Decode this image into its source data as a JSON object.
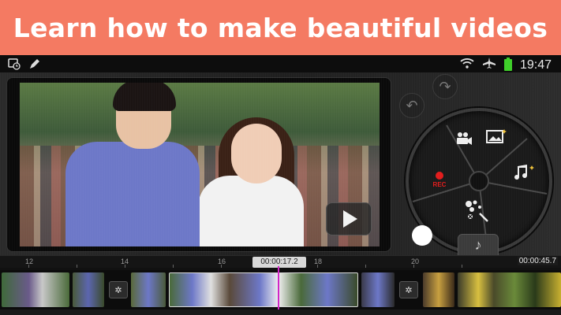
{
  "banner": {
    "title": "Learn how to make beautiful videos"
  },
  "statusbar": {
    "time": "19:47",
    "left_icons": [
      "alarm-clock-icon",
      "pencil-icon"
    ],
    "right_icons": [
      "wifi-icon",
      "airplane-icon",
      "battery-icon"
    ],
    "battery_color": "#3fcf2a"
  },
  "preview": {
    "play_label": "play"
  },
  "dial": {
    "segments": [
      "video-camera-media",
      "image-media",
      "music-add",
      "transition-fx",
      "record"
    ],
    "rec_label": "REC",
    "accent": "#e21c1c"
  },
  "timeline": {
    "ticks": [
      "12",
      "14",
      "16",
      "18",
      "20"
    ],
    "current_time": "00:00:17.2",
    "total_time": "00:00:45.7",
    "playhead_color": "#d026c8"
  },
  "colors": {
    "banner": "#f47a62"
  }
}
